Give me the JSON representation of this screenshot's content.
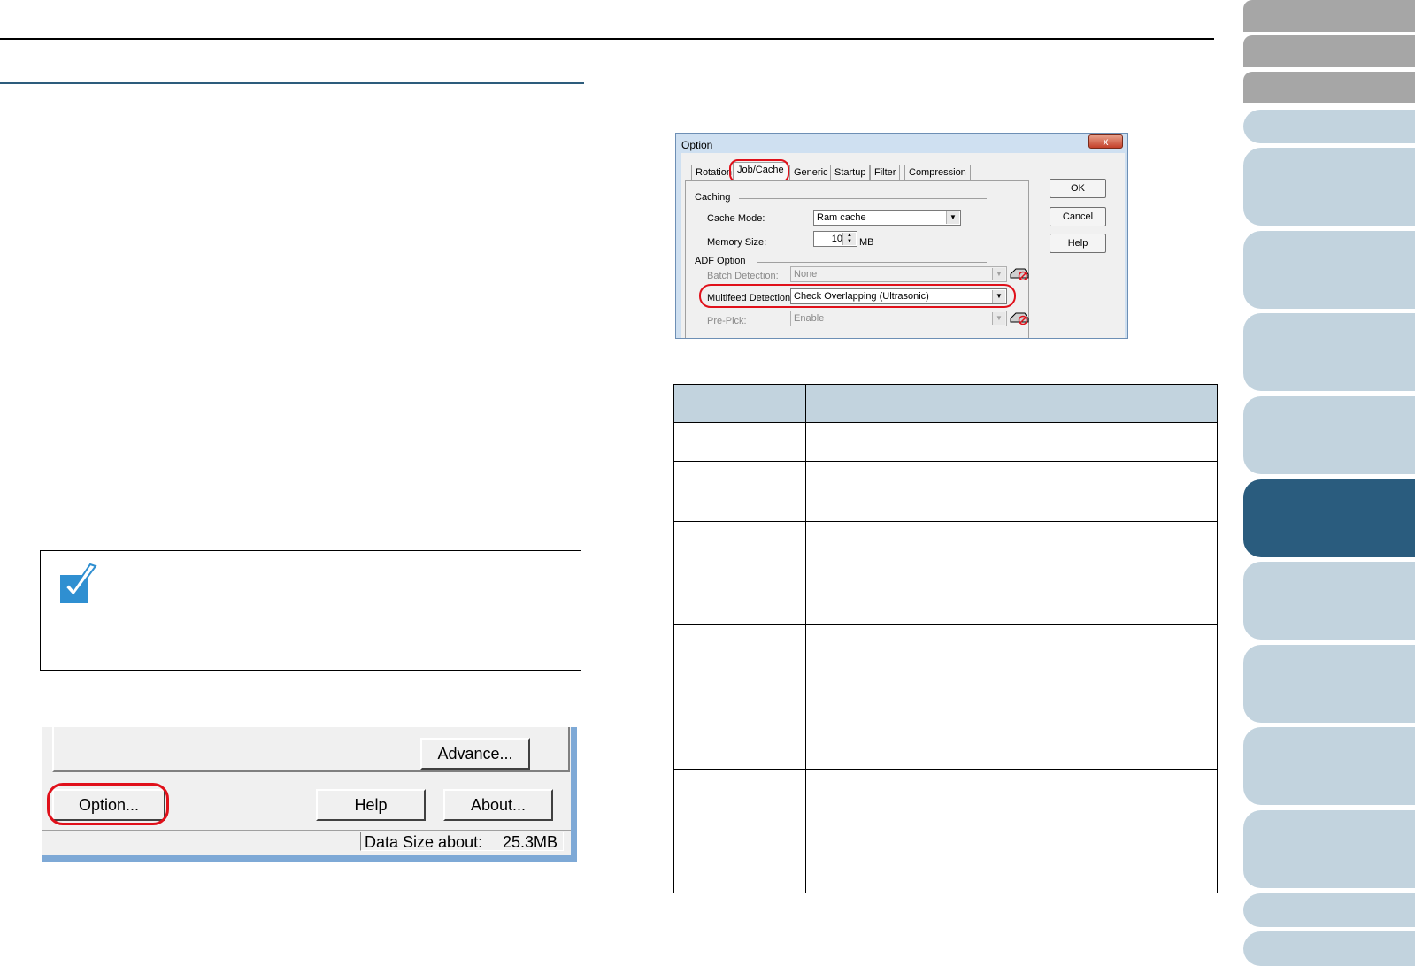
{
  "option_button_shot": {
    "advance_button": "Advance...",
    "option_button": "Option...",
    "help_button": "Help",
    "about_button": "About...",
    "status_label": "Data Size about:",
    "status_value": "25.3MB"
  },
  "option_dialog": {
    "title": "Option",
    "close_glyph": "x",
    "tabs": [
      "Rotation",
      "Job/Cache",
      "Generic",
      "Startup",
      "Filter",
      "Compression"
    ],
    "selected_tab": "Job/Cache",
    "caching_group": "Caching",
    "cache_mode_label": "Cache Mode:",
    "cache_mode_value": "Ram cache",
    "memory_size_label": "Memory Size:",
    "memory_size_value": "10",
    "memory_size_unit": "MB",
    "adf_group": "ADF Option",
    "batch_detection_label": "Batch Detection:",
    "batch_detection_value": "None",
    "multifeed_label": "Multifeed Detection:",
    "multifeed_value": "Check Overlapping (Ultrasonic)",
    "prepick_label": "Pre-Pick:",
    "prepick_value": "Enable",
    "ok_button": "OK",
    "cancel_button": "Cancel",
    "help_button": "Help",
    "icons": [
      "scanner-icon",
      "no-entry-icon"
    ]
  },
  "colors": {
    "highlight_ring": "#e0101a",
    "section_rule": "#2d5c7c",
    "table_header": "#c2d3de",
    "nav_light": "#c2d3de",
    "nav_gray": "#a6a6a6",
    "nav_active": "#2a5c7e"
  },
  "side_nav": {
    "tabs": [
      "gray",
      "gray",
      "gray",
      "light",
      "light",
      "light",
      "light",
      "light",
      "active",
      "light",
      "light",
      "light",
      "light",
      "light",
      "light"
    ]
  }
}
